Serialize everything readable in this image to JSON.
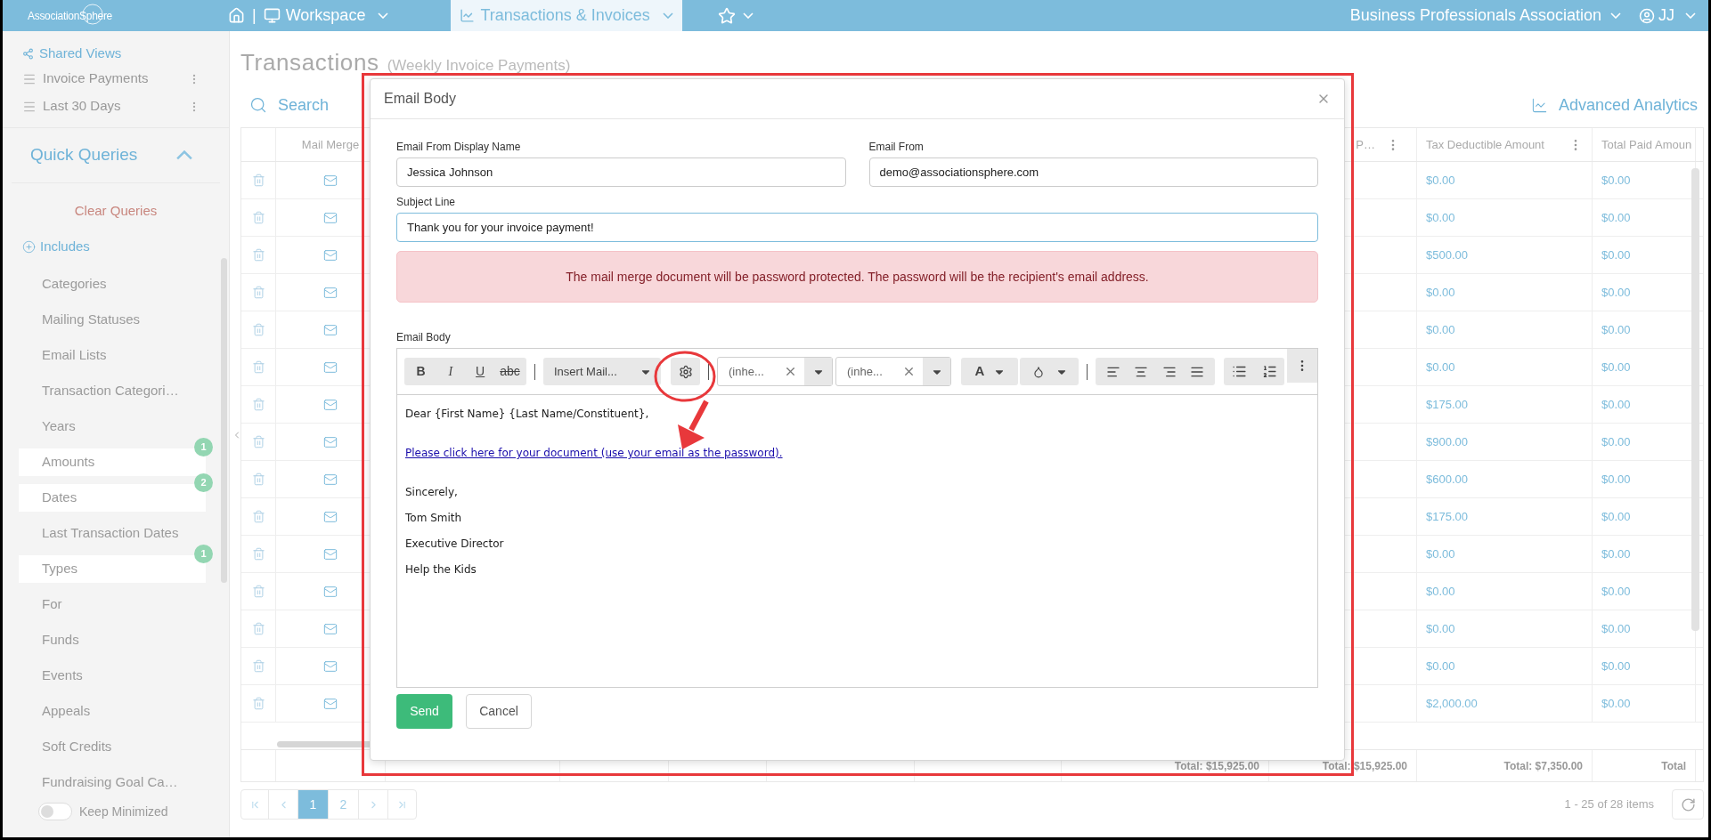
{
  "top_nav": {
    "logo": "AssociationSphere",
    "separator": "|",
    "items": [
      {
        "label": "Workspace",
        "kind": "workspace",
        "selected": false
      },
      {
        "label": "Transactions & Invoices",
        "kind": "transactions",
        "selected": true
      }
    ],
    "organization": "Business Professionals Association",
    "user": "JJ"
  },
  "sidebar": {
    "views_title": "Shared Views",
    "views": [
      "Invoice Payments",
      "Last 30 Days"
    ],
    "quick_queries": {
      "title": "Quick Queries",
      "expanded": true,
      "clear": "Clear Queries",
      "includes": "Includes",
      "items": [
        {
          "label": "Categories",
          "active": false
        },
        {
          "label": "Mailing Statuses",
          "active": false
        },
        {
          "label": "Email Lists",
          "active": false
        },
        {
          "label": "Transaction Categori…",
          "active": false
        },
        {
          "label": "Years",
          "active": false
        },
        {
          "label": "Amounts",
          "active": true,
          "badge": "1"
        },
        {
          "label": "Dates",
          "active": true,
          "badge": "2"
        },
        {
          "label": "Last Transaction Dates",
          "active": false
        },
        {
          "label": "Types",
          "active": true,
          "badge": "1"
        },
        {
          "label": "For",
          "active": false
        },
        {
          "label": "Funds",
          "active": false
        },
        {
          "label": "Events",
          "active": false
        },
        {
          "label": "Appeals",
          "active": false
        },
        {
          "label": "Soft Credits",
          "active": false
        },
        {
          "label": "Fundraising Goal Ca…",
          "active": false
        }
      ]
    },
    "keep_minimized": {
      "label": "Keep Minimized",
      "on": false
    }
  },
  "page": {
    "title": "Transactions",
    "subtitle": "(Weekly Invoice Payments)",
    "search": "Search",
    "analytics": "Advanced Analytics"
  },
  "table": {
    "columns": [
      "Mail Merge",
      "P…",
      "Tax Deductible Amount",
      "Total Paid Amoun"
    ],
    "rows": [
      {
        "tax": "$0.00",
        "total_paid": "$0.00"
      },
      {
        "tax": "$0.00",
        "total_paid": "$0.00"
      },
      {
        "tax": "$500.00",
        "total_paid": "$0.00"
      },
      {
        "tax": "$0.00",
        "total_paid": "$0.00"
      },
      {
        "tax": "$0.00",
        "total_paid": "$0.00"
      },
      {
        "tax": "$0.00",
        "total_paid": "$0.00"
      },
      {
        "tax": "$175.00",
        "total_paid": "$0.00"
      },
      {
        "tax": "$900.00",
        "total_paid": "$0.00"
      },
      {
        "tax": "$600.00",
        "total_paid": "$0.00"
      },
      {
        "tax": "$175.00",
        "total_paid": "$0.00"
      },
      {
        "tax": "$0.00",
        "total_paid": "$0.00"
      },
      {
        "tax": "$0.00",
        "total_paid": "$0.00"
      },
      {
        "tax": "$0.00",
        "total_paid": "$0.00"
      },
      {
        "tax": "$0.00",
        "total_paid": "$0.00"
      },
      {
        "tax": "$2,000.00",
        "total_paid": "$0.00"
      }
    ],
    "totals": [
      "Total: $15,925.00",
      "Total: $15,925.00",
      "Total: $7,350.00",
      "Total"
    ]
  },
  "pagination": {
    "pages": [
      {
        "label": "1",
        "selected": true
      },
      {
        "label": "2",
        "selected": false
      }
    ],
    "summary": "1 - 25 of 28 items"
  },
  "modal": {
    "title": "Email Body",
    "fields": [
      {
        "label": "Email From Display Name",
        "value": "Jessica Johnson",
        "focused": false
      },
      {
        "label": "Email From",
        "value": "demo@associationsphere.com",
        "focused": false
      },
      {
        "label": "Subject Line",
        "value": "Thank you for your invoice payment!",
        "focused": true
      }
    ],
    "alert": "The mail merge document will be password protected. The password will be the recipient's email address.",
    "editor": {
      "label": "Email Body",
      "format_buttons": [
        {
          "label": "B",
          "kind": "bold"
        },
        {
          "label": "I",
          "kind": "italic"
        },
        {
          "label": "U",
          "kind": "underline"
        },
        {
          "label": "abc",
          "kind": "strike"
        }
      ],
      "insert": "Insert Mail...",
      "font": "(inhe...",
      "size": "(inhe...",
      "text_color_label": "A",
      "lines": [
        {
          "kind": "text",
          "text": "Dear {First Name} {Last Name/Constituent},"
        },
        {
          "kind": "link",
          "text": "Please click here for your document (use your email as the password)."
        },
        {
          "kind": "text",
          "text": "Sincerely,"
        },
        {
          "kind": "text",
          "text": "Tom Smith"
        },
        {
          "kind": "text",
          "text": "Executive Director"
        },
        {
          "kind": "text",
          "text": "Help the Kids"
        }
      ]
    },
    "buttons": [
      {
        "label": "Send",
        "kind": "primary"
      },
      {
        "label": "Cancel",
        "kind": "secondary"
      }
    ]
  }
}
